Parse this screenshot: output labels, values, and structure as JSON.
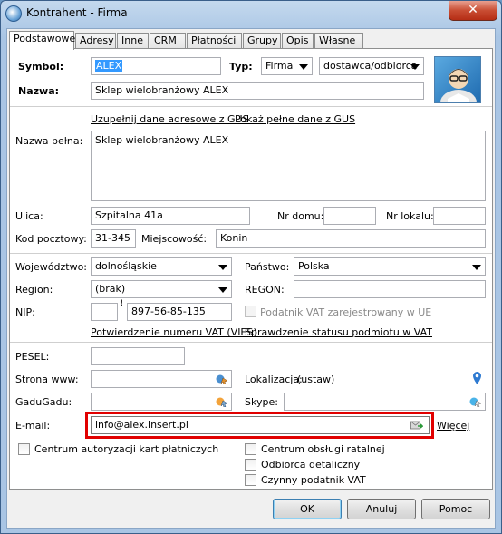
{
  "window": {
    "title": "Kontrahent - Firma",
    "close": "✕"
  },
  "tabs": [
    "Podstawowe",
    "Adresy",
    "Inne",
    "CRM",
    "Płatności",
    "Grupy",
    "Opis",
    "Własne"
  ],
  "active_tab": "Podstawowe",
  "form": {
    "symbol_label": "Symbol:",
    "symbol_value": "ALEX",
    "typ_label": "Typ:",
    "typ_value": "Firma",
    "role_value": "dostawca/odbiorca",
    "nazwa_label": "Nazwa:",
    "nazwa_value": "Sklep wielobranżowy  ALEX",
    "gus_fill_link": "Uzupełnij dane adresowe z GUS",
    "gus_show_link": "Pokaż pełne dane z GUS",
    "nazwa_pelna_label": "Nazwa pełna:",
    "nazwa_pelna_value": "Sklep wielobranżowy  ALEX",
    "ulica_label": "Ulica:",
    "ulica_value": "Szpitalna  41a",
    "nr_domu_label": "Nr domu:",
    "nr_domu_value": "",
    "nr_lokalu_label": "Nr lokalu:",
    "nr_lokalu_value": "",
    "kod_label": "Kod pocztowy:",
    "kod_value": "31-345",
    "miejscowosc_label": "Miejscowość:",
    "miejscowosc_value": "Konin",
    "wojewodztwo_label": "Województwo:",
    "wojewodztwo_value": "dolnośląskie",
    "panstwo_label": "Państwo:",
    "panstwo_value": "Polska",
    "region_label": "Region:",
    "region_value": "(brak)",
    "regon_label": "REGON:",
    "regon_value": "",
    "nip_label": "NIP:",
    "nip_prefix": "",
    "nip_value": "897-56-85-135",
    "vat_ue_label": "Podatnik VAT zarejestrowany w UE",
    "vies_link": "Potwierdzenie numeru VAT (VIES)",
    "vat_status_link": "Sprawdzenie statusu podmiotu w VAT",
    "pesel_label": "PESEL:",
    "pesel_value": "",
    "www_label": "Strona www:",
    "www_value": "",
    "lokalizacja_label": "Lokalizacja:",
    "lokalizacja_link": "(ustaw)",
    "gadugadu_label": "GaduGadu:",
    "gadugadu_value": "",
    "skype_label": "Skype:",
    "skype_value": "",
    "email_label": "E-mail:",
    "email_value": "info@alex.insert.pl",
    "wiecej_link": "Więcej",
    "chk_karty": "Centrum autoryzacji kart płatniczych",
    "chk_raty": "Centrum obsługi ratalnej",
    "chk_detal": "Odbiorca detaliczny",
    "chk_vat": "Czynny podatnik VAT"
  },
  "buttons": {
    "ok": "OK",
    "cancel": "Anuluj",
    "help": "Pomoc"
  },
  "colors": {
    "highlight": "#e10000",
    "selection": "#3399ff",
    "close": "#c94d33"
  }
}
